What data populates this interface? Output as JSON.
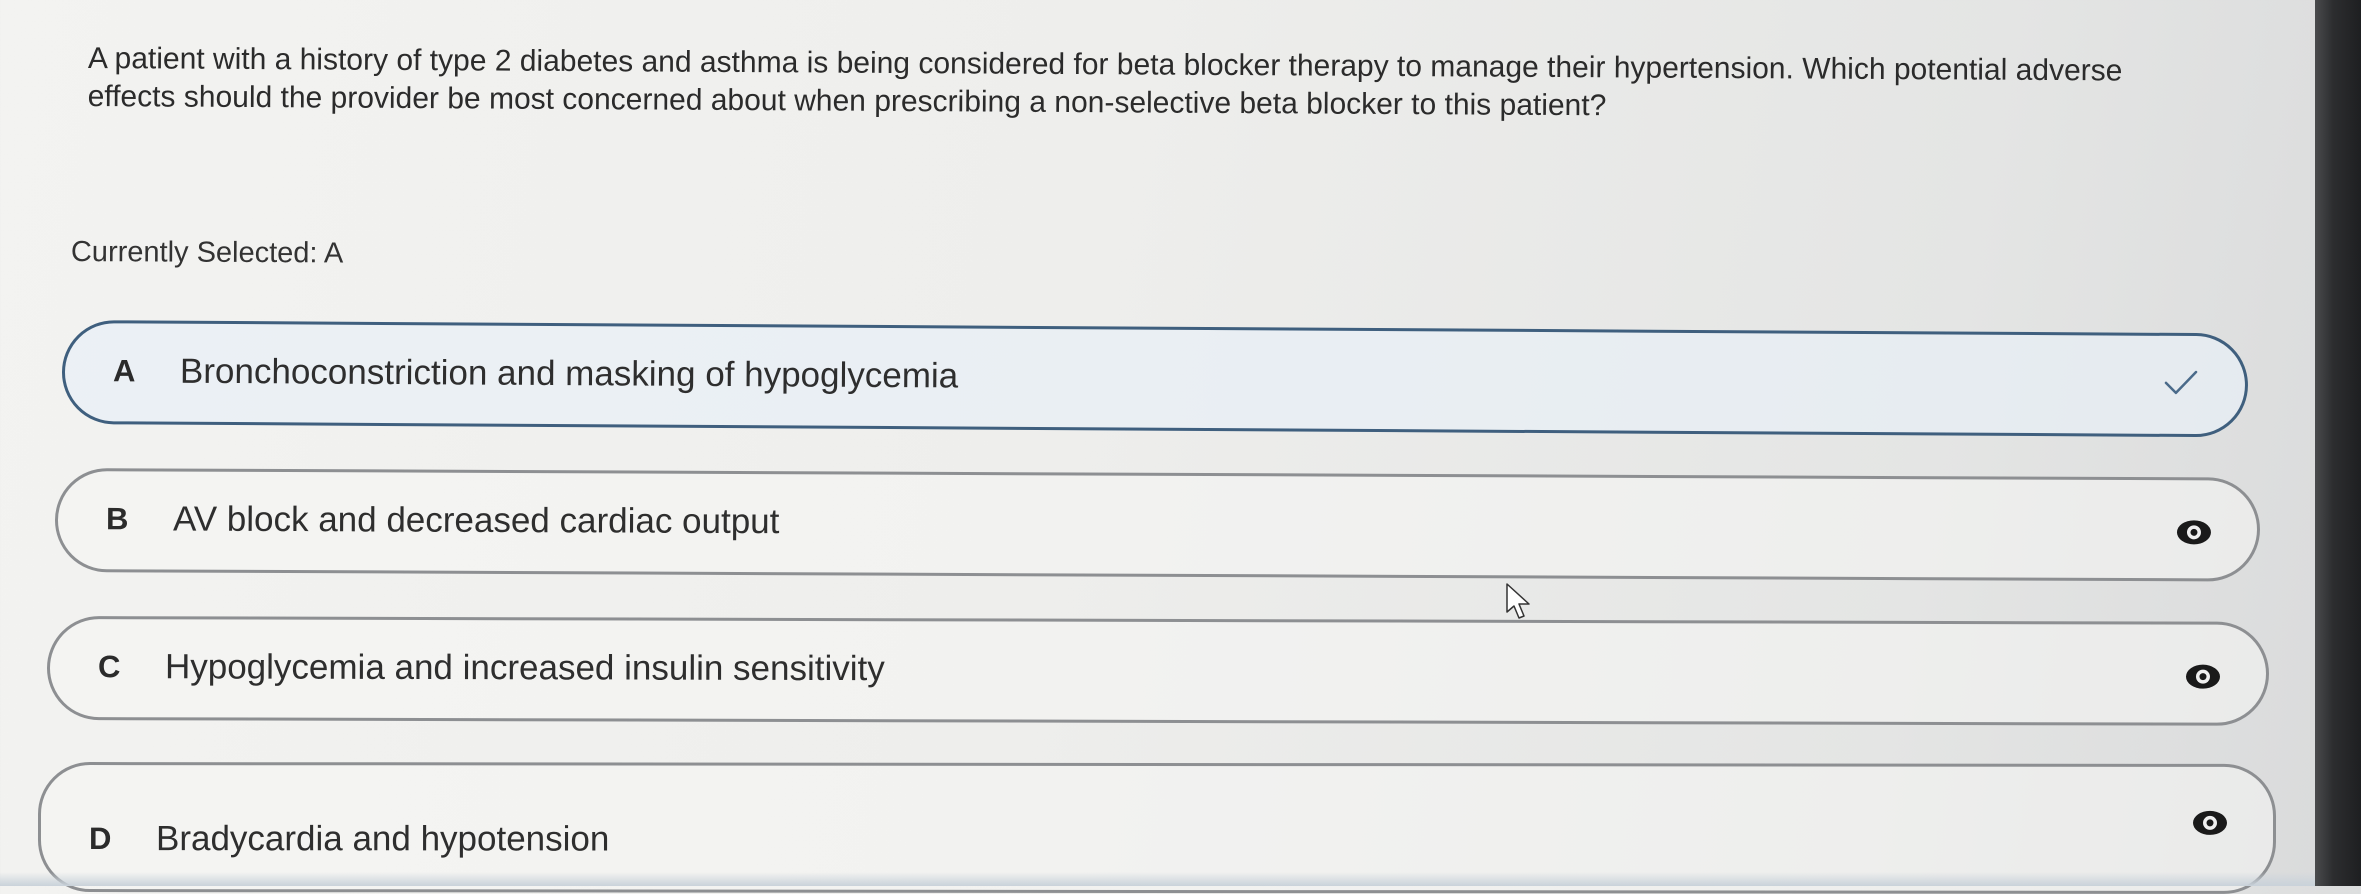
{
  "question": {
    "text": "A patient with a history of type 2 diabetes and asthma is being considered for beta blocker therapy to manage their hypertension. Which potential adverse effects should the provider be most concerned about when prescribing a non-selective beta blocker to this patient?"
  },
  "selection": {
    "status_text": "Currently Selected: A"
  },
  "options": [
    {
      "letter": "A",
      "text": "Bronchoconstriction and masking of hypoglycemia",
      "selected": true,
      "icon": "check-icon"
    },
    {
      "letter": "B",
      "text": "AV block and decreased cardiac output",
      "selected": false,
      "icon": "eye-icon"
    },
    {
      "letter": "C",
      "text": "Hypoglycemia and increased insulin sensitivity",
      "selected": false,
      "icon": "eye-icon"
    },
    {
      "letter": "D",
      "text": "Bradycardia and hypotension",
      "selected": false,
      "icon": "eye-icon"
    }
  ],
  "colors": {
    "selected_border": "#3f5f7e",
    "default_border": "#8d8f92",
    "check": "#4a6a8a",
    "eye": "#1a1a1a"
  }
}
